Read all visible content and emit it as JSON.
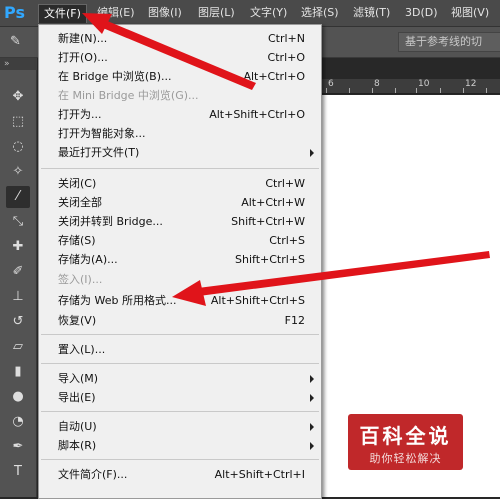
{
  "app": {
    "logo": "Ps"
  },
  "menubar": {
    "items": [
      {
        "label": "文件(F)"
      },
      {
        "label": "编辑(E)"
      },
      {
        "label": "图像(I)"
      },
      {
        "label": "图层(L)"
      },
      {
        "label": "文字(Y)"
      },
      {
        "label": "选择(S)"
      },
      {
        "label": "滤镜(T)"
      },
      {
        "label": "3D(D)"
      },
      {
        "label": "视图(V)"
      }
    ]
  },
  "optionsbar": {
    "field_text": "基于参考线的切"
  },
  "toolbar": {
    "grip": "»"
  },
  "ruler": {
    "labels": [
      "6",
      "8",
      "10",
      "12"
    ]
  },
  "file_menu": {
    "items": [
      {
        "label": "新建(N)...",
        "shortcut": "Ctrl+N"
      },
      {
        "label": "打开(O)...",
        "shortcut": "Ctrl+O"
      },
      {
        "label": "在 Bridge 中浏览(B)...",
        "shortcut": "Alt+Ctrl+O"
      },
      {
        "label": "在 Mini Bridge 中浏览(G)...",
        "shortcut": "",
        "disabled": true
      },
      {
        "label": "打开为...",
        "shortcut": "Alt+Shift+Ctrl+O"
      },
      {
        "label": "打开为智能对象...",
        "shortcut": ""
      },
      {
        "label": "最近打开文件(T)",
        "shortcut": "",
        "submenu": true
      },
      {
        "label": "关闭(C)",
        "shortcut": "Ctrl+W"
      },
      {
        "label": "关闭全部",
        "shortcut": "Alt+Ctrl+W"
      },
      {
        "label": "关闭并转到 Bridge...",
        "shortcut": "Shift+Ctrl+W"
      },
      {
        "label": "存储(S)",
        "shortcut": "Ctrl+S"
      },
      {
        "label": "存储为(A)...",
        "shortcut": "Shift+Ctrl+S"
      },
      {
        "label": "签入(I)...",
        "shortcut": "",
        "disabled": true
      },
      {
        "label": "存储为 Web 所用格式...",
        "shortcut": "Alt+Shift+Ctrl+S"
      },
      {
        "label": "恢复(V)",
        "shortcut": "F12"
      },
      {
        "label": "置入(L)...",
        "shortcut": ""
      },
      {
        "label": "导入(M)",
        "shortcut": "",
        "submenu": true
      },
      {
        "label": "导出(E)",
        "shortcut": "",
        "submenu": true
      },
      {
        "label": "自动(U)",
        "shortcut": "",
        "submenu": true
      },
      {
        "label": "脚本(R)",
        "shortcut": "",
        "submenu": true
      },
      {
        "label": "文件简介(F)...",
        "shortcut": "Alt+Shift+Ctrl+I"
      }
    ]
  },
  "watermark": {
    "title": "百科全说",
    "subtitle": "助你轻松解决"
  },
  "colors": {
    "arrow": "#e0141a",
    "ps_blue": "#31a8ff",
    "watermark_bg": "#c0282a"
  }
}
